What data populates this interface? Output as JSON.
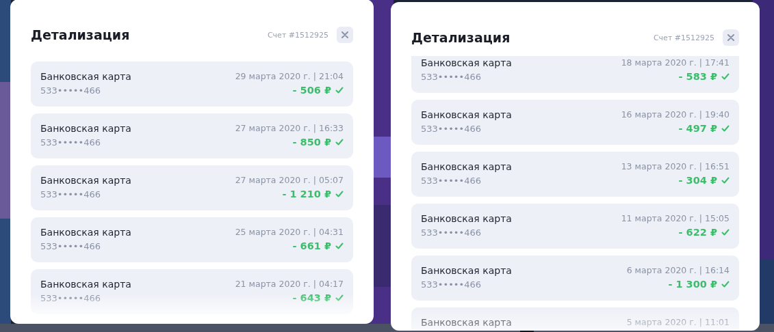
{
  "modals": [
    {
      "title": "Детализация",
      "account": "Счет #1512925",
      "transactions": [
        {
          "method": "Банковская карта",
          "card": "533•••••466",
          "datetime": "29 марта 2020 г. | 21:04",
          "amount": "- 506 ₽",
          "confirmed": true
        },
        {
          "method": "Банковская карта",
          "card": "533•••••466",
          "datetime": "27 марта 2020 г. | 16:33",
          "amount": "- 850 ₽",
          "confirmed": true
        },
        {
          "method": "Банковская карта",
          "card": "533•••••466",
          "datetime": "27 марта 2020 г. | 05:07",
          "amount": "- 1 210 ₽",
          "confirmed": true
        },
        {
          "method": "Банковская карта",
          "card": "533•••••466",
          "datetime": "25 марта 2020 г. | 04:31",
          "amount": "- 661 ₽",
          "confirmed": true
        },
        {
          "method": "Банковская карта",
          "card": "533•••••466",
          "datetime": "21 марта 2020 г. | 04:17",
          "amount": "- 643 ₽",
          "confirmed": true
        }
      ]
    },
    {
      "title": "Детализация",
      "account": "Счет #1512925",
      "transactions": [
        {
          "method": "Банковская карта",
          "card": "533•••••466",
          "datetime": "18 марта 2020 г. | 17:41",
          "amount": "- 583 ₽",
          "confirmed": true
        },
        {
          "method": "Банковская карта",
          "card": "533•••••466",
          "datetime": "16 марта 2020 г. | 19:40",
          "amount": "- 497 ₽",
          "confirmed": true
        },
        {
          "method": "Банковская карта",
          "card": "533•••••466",
          "datetime": "13 марта 2020 г. | 16:51",
          "amount": "- 304 ₽",
          "confirmed": true
        },
        {
          "method": "Банковская карта",
          "card": "533•••••466",
          "datetime": "11 марта 2020 г. | 15:05",
          "amount": "- 622 ₽",
          "confirmed": true
        },
        {
          "method": "Банковская карта",
          "card": "533•••••466",
          "datetime": "6 марта 2020 г. | 16:14",
          "amount": "- 1 300 ₽",
          "confirmed": true
        },
        {
          "method": "Банковская карта",
          "datetime": "5 марта 2020 г. | 11:01"
        }
      ]
    }
  ]
}
